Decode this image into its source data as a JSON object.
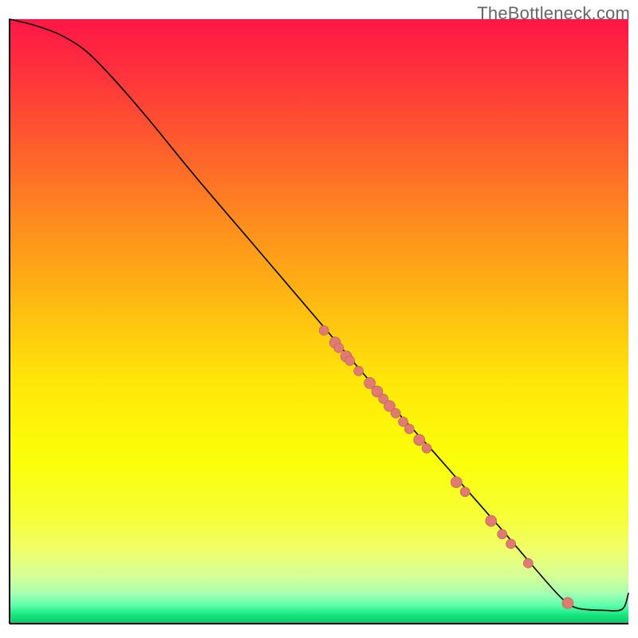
{
  "watermark": "TheBottleneck.com",
  "colors": {
    "dot_fill": "#e07b73",
    "dot_stroke": "#bb5a53",
    "curve": "#000000"
  },
  "chart_data": {
    "type": "line",
    "title": "",
    "xlabel": "",
    "ylabel": "",
    "xlim": [
      0,
      100
    ],
    "ylim": [
      0,
      100
    ],
    "series": [
      {
        "name": "curve",
        "x": [
          0,
          4,
          8,
          12,
          16,
          22,
          30,
          40,
          50,
          60,
          68,
          74,
          80,
          85,
          88,
          90,
          92,
          96,
          99,
          100
        ],
        "y": [
          100,
          99,
          97.5,
          95,
          91,
          84,
          74,
          62,
          50,
          38,
          29,
          22,
          15,
          9,
          5.5,
          3.5,
          2.5,
          2.2,
          2.4,
          5
        ]
      }
    ],
    "points": [
      {
        "x": 50.8,
        "y": 48.5,
        "r": 6
      },
      {
        "x": 52.6,
        "y": 46.5,
        "r": 7
      },
      {
        "x": 53.2,
        "y": 45.6,
        "r": 6
      },
      {
        "x": 54.4,
        "y": 44.2,
        "r": 7
      },
      {
        "x": 55.0,
        "y": 43.5,
        "r": 6
      },
      {
        "x": 56.4,
        "y": 41.8,
        "r": 6
      },
      {
        "x": 58.2,
        "y": 39.8,
        "r": 7
      },
      {
        "x": 59.4,
        "y": 38.4,
        "r": 7
      },
      {
        "x": 60.4,
        "y": 37.2,
        "r": 6
      },
      {
        "x": 61.4,
        "y": 36.0,
        "r": 7
      },
      {
        "x": 62.4,
        "y": 34.8,
        "r": 6
      },
      {
        "x": 63.6,
        "y": 33.4,
        "r": 6
      },
      {
        "x": 64.6,
        "y": 32.2,
        "r": 6
      },
      {
        "x": 66.2,
        "y": 30.4,
        "r": 7
      },
      {
        "x": 67.4,
        "y": 29.0,
        "r": 6
      },
      {
        "x": 72.2,
        "y": 23.4,
        "r": 7
      },
      {
        "x": 73.6,
        "y": 21.8,
        "r": 6
      },
      {
        "x": 77.8,
        "y": 17.0,
        "r": 7
      },
      {
        "x": 79.6,
        "y": 14.8,
        "r": 6
      },
      {
        "x": 81.0,
        "y": 13.2,
        "r": 6
      },
      {
        "x": 83.8,
        "y": 10.0,
        "r": 6
      },
      {
        "x": 90.2,
        "y": 3.4,
        "r": 7
      }
    ],
    "grid": false,
    "legend": false
  }
}
